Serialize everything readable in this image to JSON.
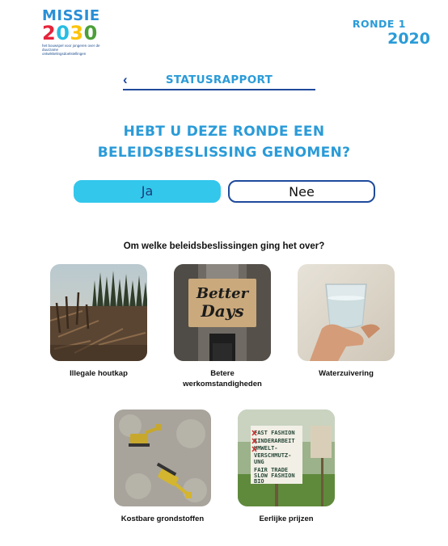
{
  "logo": {
    "word": "MISSIE",
    "digits": [
      "2",
      "0",
      "3",
      "0"
    ],
    "digit_colors": [
      "#e5243b",
      "#26bde2",
      "#fcc30b",
      "#4c9f38"
    ],
    "tagline_1": "het bouwspel voor jongeren over de",
    "tagline_2": "duurzame ontwikkelingsdoelstellingen"
  },
  "round": {
    "label": "RONDE 1",
    "year": "2020"
  },
  "status": {
    "back_glyph": "‹",
    "title": "STATUSRAPPORT"
  },
  "question": {
    "line1": "HEBT U DEZE RONDE EEN",
    "line2": "BELEIDSBESLISSING GENOMEN?"
  },
  "answers": {
    "yes": "Ja",
    "no": "Nee",
    "selected": "Ja"
  },
  "subquestion": "Om welke beleidsbeslissingen ging het over?",
  "decisions": [
    {
      "label": "Illegale houtkap"
    },
    {
      "label_1": "Betere",
      "label_2": "werkomstandigheden"
    },
    {
      "label": "Waterzuivering"
    },
    {
      "label": "Kostbare grondstoffen"
    },
    {
      "label": "Eerlijke prijzen"
    }
  ],
  "photo_text": {
    "sign_1": "Better",
    "sign_2": "Days",
    "fair_1": "FAST FASHION",
    "fair_2": "KINDERARBEIT",
    "fair_3": "UMWELT-",
    "fair_4": "VERSCHMUTZ-",
    "fair_5": "UNG",
    "fair_6": "FAIR TRADE",
    "fair_7": "SLOW FASHION",
    "fair_8": "BIO"
  },
  "colors": {
    "accent": "#2a9bd8",
    "navy": "#1f4a9c",
    "button_active": "#33c7ec"
  }
}
